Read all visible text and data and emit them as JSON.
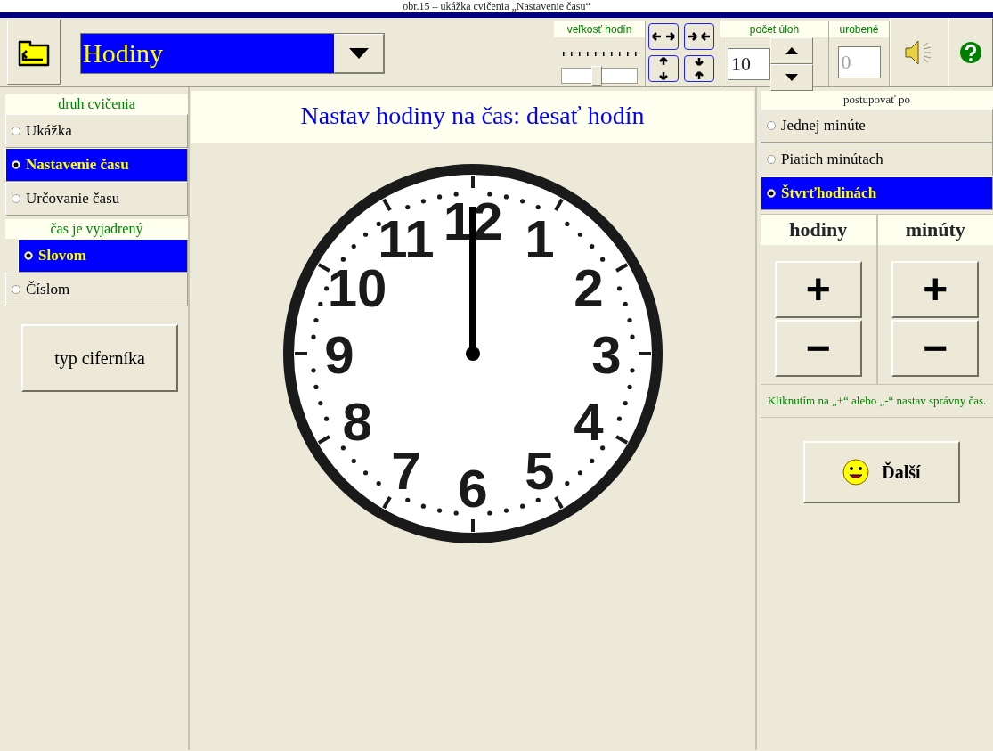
{
  "caption": "obr.15 – ukážka cvičenia „Nastavenie času“",
  "toolbar": {
    "topic": "Hodiny",
    "clock_size": {
      "label": "veľkosť hodín",
      "level": 0.45
    },
    "task_count": {
      "label": "počet úloh",
      "value": "10"
    },
    "done": {
      "label": "urobené",
      "value": "0",
      "disabled": true
    }
  },
  "exercise_type": {
    "title": "druh cvičenia",
    "options": [
      {
        "label": "Ukážka",
        "selected": false
      },
      {
        "label": "Nastavenie času",
        "selected": true
      },
      {
        "label": "Určovanie času",
        "selected": false
      }
    ]
  },
  "expressed": {
    "title": "čas je vyjadrený",
    "options": [
      {
        "label": "Slovom",
        "selected": true
      },
      {
        "label": "Číslom",
        "selected": false
      }
    ]
  },
  "dial_button": "typ ciferníka",
  "task": "Nastav hodiny na čas: desať hodín",
  "clock": {
    "numerals": [
      "12",
      "11",
      "1",
      "10",
      "2",
      "9",
      "3",
      "8",
      "4",
      "7",
      "5",
      "6"
    ]
  },
  "step": {
    "title": "postupovať po",
    "options": [
      {
        "label": "Jednej minúte",
        "selected": false
      },
      {
        "label": "Piatich minútach",
        "selected": false
      },
      {
        "label": "Štvrťhodinách",
        "selected": true
      }
    ]
  },
  "adjust": {
    "columns": [
      {
        "label": "hodiny",
        "plus": "+",
        "minus": "−"
      },
      {
        "label": "minúty",
        "plus": "+",
        "minus": "−"
      }
    ]
  },
  "hint": "Kliknutím na „+“ alebo „-“ nastav správny čas.",
  "next_button": "Ďalší"
}
